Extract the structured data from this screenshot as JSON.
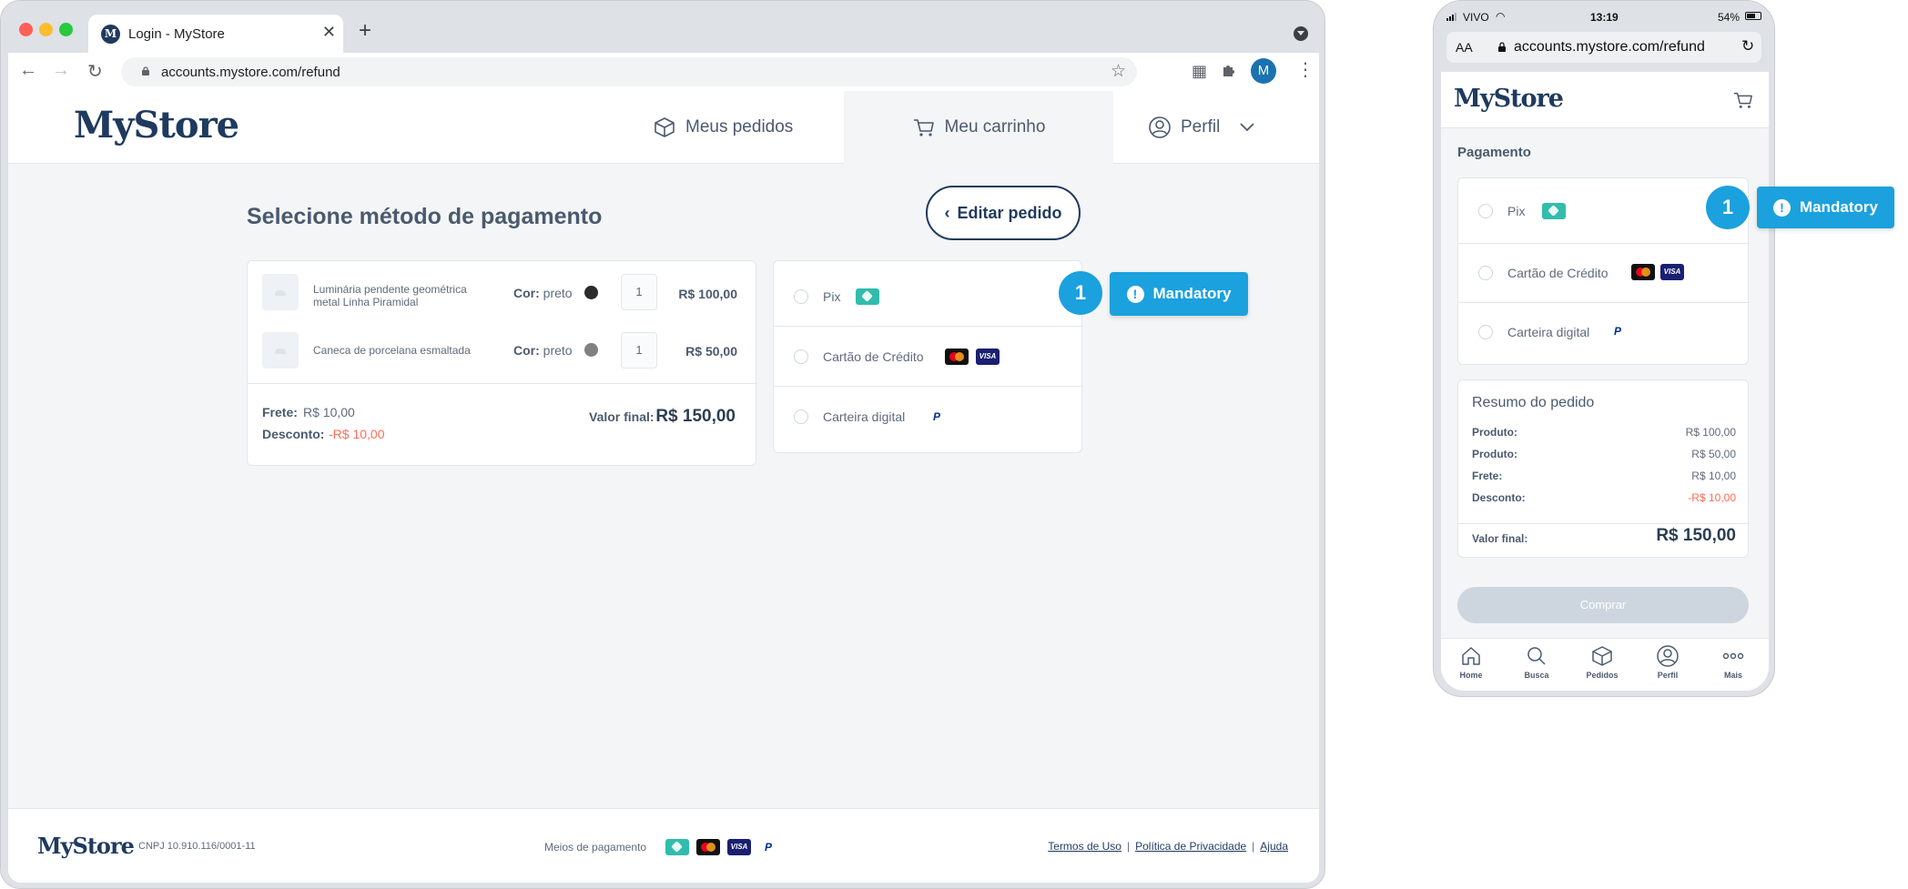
{
  "browser": {
    "tab_title": "Login - MyStore",
    "tab_favicon_letter": "M",
    "url": "accounts.mystore.com/refund",
    "avatar_letter": "M"
  },
  "site": {
    "logo": "MyStore",
    "nav": {
      "orders": "Meus pedidos",
      "cart": "Meu carrinho",
      "profile": "Perfil"
    }
  },
  "checkout": {
    "title": "Selecione método de pagamento",
    "edit_button": "Editar pedido",
    "items": [
      {
        "name": "Luminária pendente geométrica metal Linha Piramidal",
        "color_label": "Cor:",
        "color": "preto",
        "qty": "1",
        "price": "R$ 100,00"
      },
      {
        "name": "Caneca de porcelana esmaltada",
        "color_label": "Cor:",
        "color": "preto",
        "qty": "1",
        "price": "R$ 50,00"
      }
    ],
    "shipping_label": "Frete:",
    "shipping_value": "R$ 10,00",
    "discount_label": "Desconto:",
    "discount_value": "-R$ 10,00",
    "final_label": "Valor final:",
    "final_value": "R$ 150,00"
  },
  "payment_methods": [
    {
      "label": "Pix",
      "icon": "pix-icon"
    },
    {
      "label": "Cartão de Crédito",
      "icon": "mastercard-visa-icons"
    },
    {
      "label": "Carteira digital",
      "icon": "paypal-icon"
    }
  ],
  "annotation": {
    "step": "1",
    "label": "Mandatory"
  },
  "footer": {
    "logo": "MyStore",
    "cnpj": "CNPJ 10.910.116/0001-11",
    "payment_methods_label": "Meios de pagamento",
    "links": [
      "Termos de Uso",
      "Política de Privacidade",
      "Ajuda"
    ],
    "separator": "|"
  },
  "mobile": {
    "carrier": "VIVO",
    "time": "13:19",
    "battery": "54%",
    "text_size": "AA",
    "url": "accounts.mystore.com/refund",
    "logo": "MyStore",
    "payment_title": "Pagamento",
    "summary": {
      "title": "Resumo do pedido",
      "rows": [
        {
          "label": "Produto:",
          "value": "R$ 100,00"
        },
        {
          "label": "Produto:",
          "value": "R$ 50,00"
        },
        {
          "label": "Frete:",
          "value": "R$ 10,00"
        },
        {
          "label": "Desconto:",
          "value": "-R$ 10,00"
        }
      ],
      "final_label": "Valor final:",
      "final_value": "R$ 150,00"
    },
    "buy_button": "Comprar",
    "tabs": [
      "Home",
      "Busca",
      "Pedidos",
      "Perfil",
      "Mais"
    ]
  },
  "colors": {
    "brand": "#1f3a5f",
    "accent": "#1ba1dd",
    "negative": "#ff6b57",
    "pix": "#32bcad"
  }
}
